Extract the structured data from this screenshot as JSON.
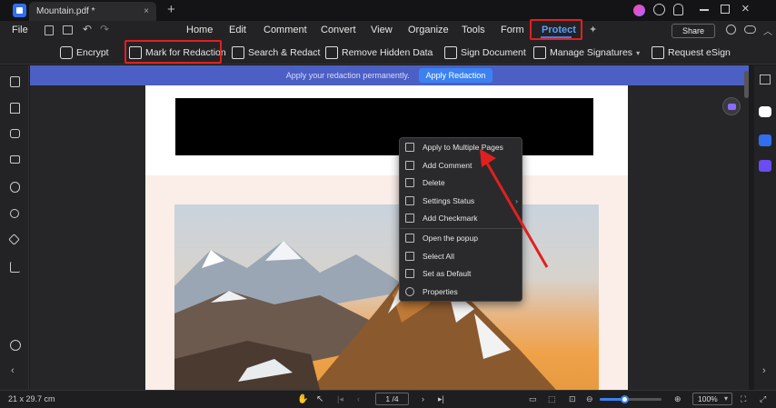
{
  "window": {
    "tab_title": "Mountain.pdf *",
    "tab_close": "×",
    "new_tab": "+"
  },
  "menubar": {
    "file": "File",
    "items": [
      "Home",
      "Edit",
      "Comment",
      "Convert",
      "View",
      "Organize",
      "Tools",
      "Form",
      "Protect"
    ],
    "share": "Share"
  },
  "toolbar": {
    "encrypt": "Encrypt",
    "mark_for_redaction": "Mark for Redaction",
    "search_redact": "Search & Redact",
    "remove_hidden_data": "Remove Hidden Data",
    "sign_document": "Sign Document",
    "manage_signatures": "Manage Signatures",
    "request_esign": "Request eSign"
  },
  "banner": {
    "text": "Apply your redaction permanently.",
    "button": "Apply Redaction"
  },
  "context_menu": {
    "items": [
      "Apply to Multiple Pages",
      "Add Comment",
      "Delete",
      "Settings Status",
      "Add Checkmark",
      "Open the popup",
      "Select All",
      "Set as Default",
      "Properties"
    ]
  },
  "statusbar": {
    "page_size": "21 x 29.7 cm",
    "page_input": "1 /4",
    "zoom": "100%"
  },
  "colors": {
    "accent": "#3b82f0",
    "highlight": "#e02020",
    "banner": "#4c5fc4"
  }
}
